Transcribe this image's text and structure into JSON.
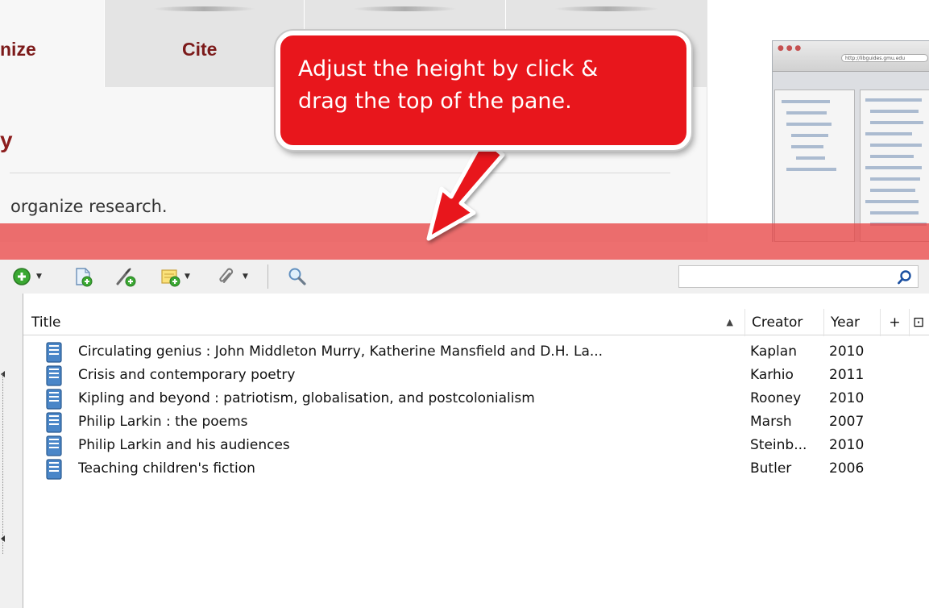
{
  "web_page": {
    "tabs": [
      {
        "label": "nize"
      },
      {
        "label": "Cite"
      },
      {
        "label": ""
      },
      {
        "label": ""
      }
    ],
    "heading_fragment": "y",
    "tagline": "organize research."
  },
  "thumbnail": {
    "url_text": "http://libguides.gmu.edu"
  },
  "callout": {
    "line1": "Adjust the height by click &",
    "line2": "drag the top of the pane.",
    "color": "#e8161c"
  },
  "resize_band": {
    "color": "#e84646"
  },
  "toolbar": {
    "buttons": [
      {
        "icon": "new-item-icon",
        "has_dropdown": true
      },
      {
        "icon": "new-item-by-identifier-icon",
        "has_dropdown": false
      },
      {
        "icon": "add-note-icon",
        "has_dropdown": false
      },
      {
        "icon": "add-standalone-note-icon",
        "has_dropdown": true
      },
      {
        "icon": "attachment-icon",
        "has_dropdown": true
      },
      {
        "icon": "advanced-search-icon",
        "has_dropdown": false
      }
    ],
    "search": {
      "value": "",
      "placeholder": ""
    }
  },
  "items_tree": {
    "columns": {
      "title": "Title",
      "creator": "Creator",
      "year": "Year",
      "plus": "+",
      "picker": "⊡"
    },
    "sort_indicator": "▲",
    "rows": [
      {
        "title": "Circulating genius : John Middleton Murry, Katherine Mansfield and D.H. La...",
        "creator": "Kaplan",
        "year": "2010"
      },
      {
        "title": "Crisis and contemporary poetry",
        "creator": "Karhio",
        "year": "2011"
      },
      {
        "title": "Kipling and beyond : patriotism, globalisation, and postcolonialism",
        "creator": "Rooney",
        "year": "2010"
      },
      {
        "title": "Philip Larkin : the poems",
        "creator": "Marsh",
        "year": "2007"
      },
      {
        "title": "Philip Larkin and his audiences",
        "creator": "Steinb...",
        "year": "2010"
      },
      {
        "title": "Teaching children's fiction",
        "creator": "Butler",
        "year": "2006"
      }
    ]
  }
}
